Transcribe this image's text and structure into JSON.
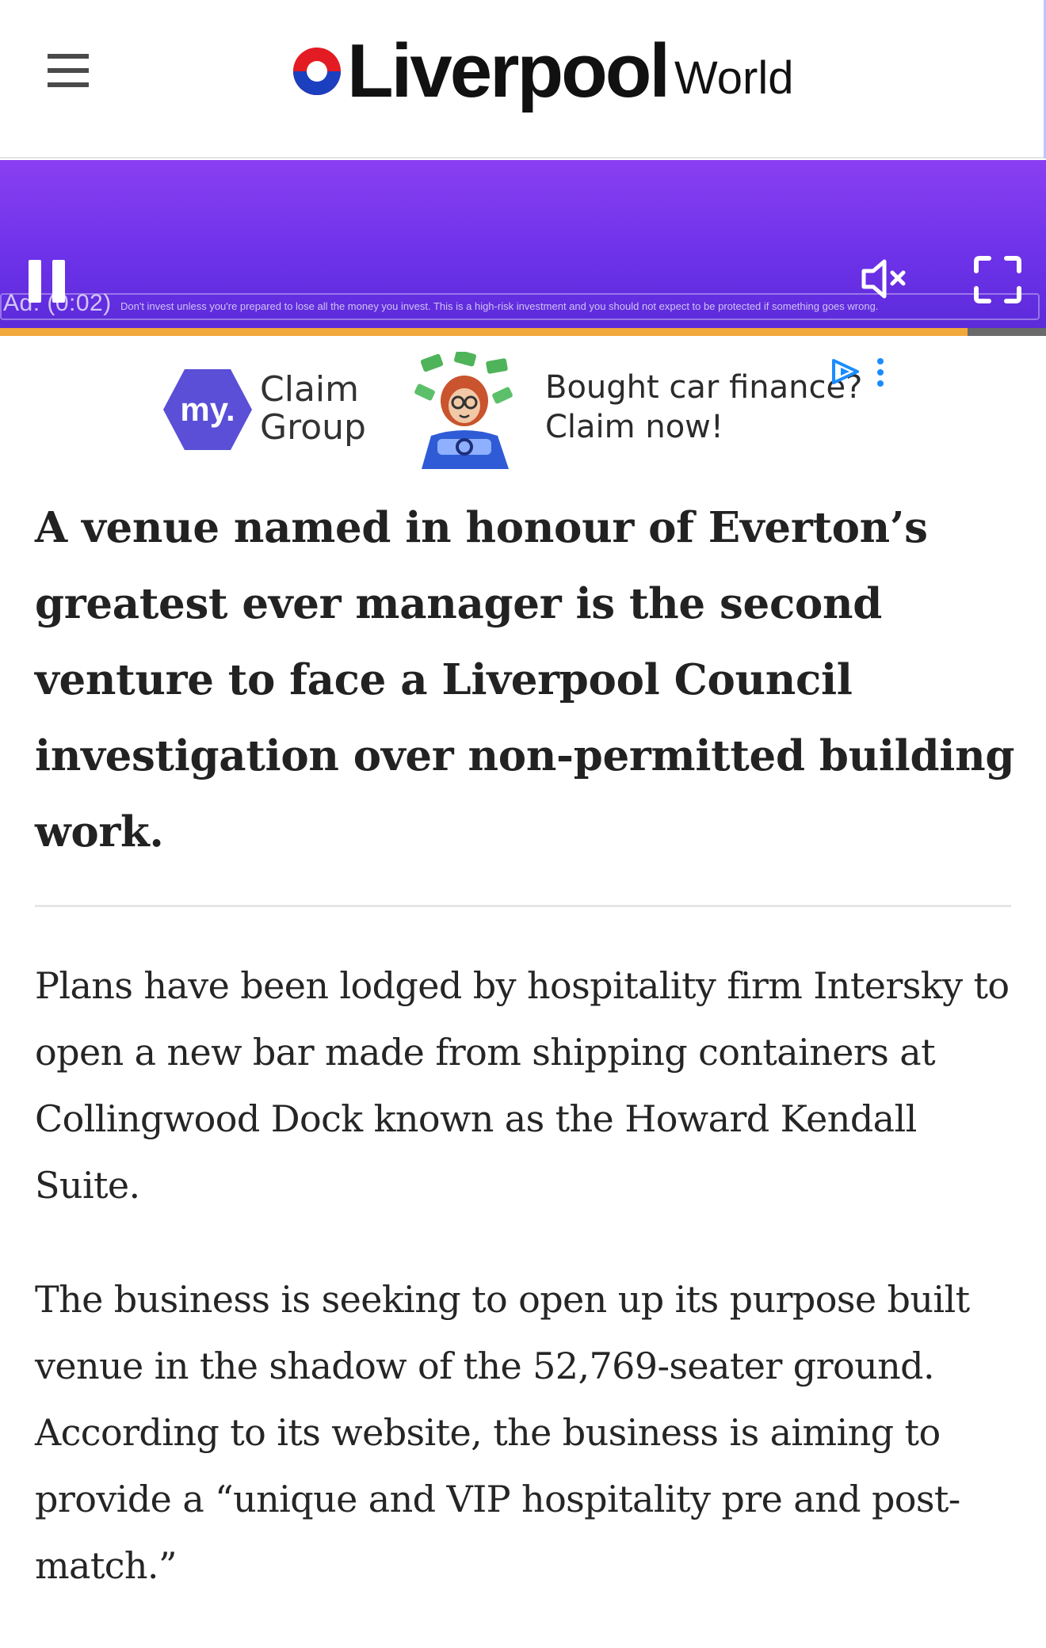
{
  "header": {
    "logo_main": "Liverpool",
    "logo_sub": "World",
    "menu_icon": "hamburger-menu-icon"
  },
  "video_ad": {
    "timer": "Ad: (0:02)",
    "disclaimer": "Don't invest unless you're prepared to lose all the money you invest. This is a high-risk investment and you should not expect to be protected if something goes wrong.",
    "progress_fraction": 0.925,
    "colors": {
      "background": "#6d32e8",
      "progress": "#f2a93b"
    },
    "icons": [
      "pause-icon",
      "mute-icon",
      "fullscreen-icon"
    ]
  },
  "display_ad": {
    "logo_text": "my.",
    "brand_line1": "Claim",
    "brand_line2": "Group",
    "copy_line1": "Bought car finance?",
    "copy_line2": "Claim now!",
    "colors": {
      "logo": "#5a4fd6"
    },
    "icons": [
      "adchoices-icon",
      "ad-menu-icon"
    ]
  },
  "article": {
    "headline": "A venue named in honour of Everton’s greatest ever manager is the second venture to face a Liverpool Council investigation over non-permitted building work.",
    "paragraphs": [
      "Plans have been lodged by hospitality firm Intersky to open a new bar made from shipping containers at Collingwood Dock known as the Howard Kendall Suite.",
      "The business is seeking to open up its purpose built venue in the shadow of the 52,769-seater ground. According to its website, the business is aiming to provide a “unique and VIP hospitality pre and post-match.”"
    ]
  }
}
